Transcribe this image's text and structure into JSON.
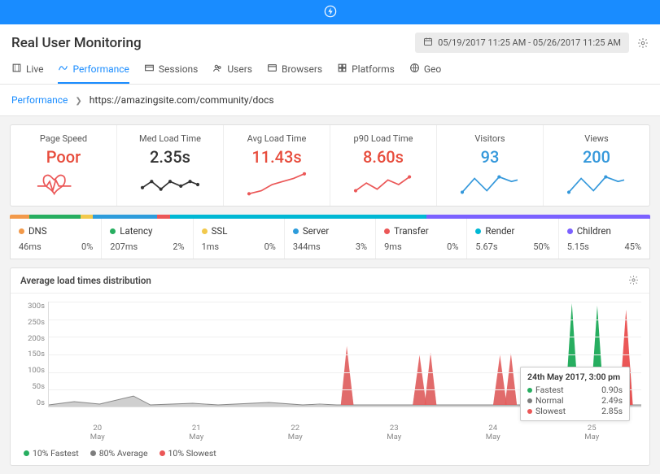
{
  "header": {
    "title": "Real User Monitoring",
    "date_range": "05/19/2017 11:25 AM - 05/26/2017 11:25 AM"
  },
  "tabs": [
    {
      "id": "live",
      "label": "Live"
    },
    {
      "id": "performance",
      "label": "Performance",
      "active": true
    },
    {
      "id": "sessions",
      "label": "Sessions"
    },
    {
      "id": "users",
      "label": "Users"
    },
    {
      "id": "browsers",
      "label": "Browsers"
    },
    {
      "id": "platforms",
      "label": "Platforms"
    },
    {
      "id": "geo",
      "label": "Geo"
    }
  ],
  "breadcrumb": {
    "root": "Performance",
    "path": "https://amazingsite.com/community/docs"
  },
  "metrics": [
    {
      "label": "Page Speed",
      "value": "Poor",
      "color": "red",
      "spark": "heart"
    },
    {
      "label": "Med Load Time",
      "value": "2.35s",
      "color": "black",
      "spark": "black-line"
    },
    {
      "label": "Avg Load Time",
      "value": "11.43s",
      "color": "red",
      "spark": "red-line"
    },
    {
      "label": "p90 Load Time",
      "value": "8.60s",
      "color": "red",
      "spark": "red-line2"
    },
    {
      "label": "Visitors",
      "value": "93",
      "color": "blue",
      "spark": "blue-line"
    },
    {
      "label": "Views",
      "value": "200",
      "color": "blue",
      "spark": "blue-line"
    }
  ],
  "timing": [
    {
      "name": "DNS",
      "color": "#f2994a",
      "ms": "46ms",
      "pct": "0%",
      "bar": 3
    },
    {
      "name": "Latency",
      "color": "#27ae60",
      "ms": "207ms",
      "pct": "2%",
      "bar": 8
    },
    {
      "name": "SSL",
      "color": "#f2c94c",
      "ms": "1ms",
      "pct": "0%",
      "bar": 2
    },
    {
      "name": "Server",
      "color": "#2d9cdb",
      "ms": "344ms",
      "pct": "3%",
      "bar": 10
    },
    {
      "name": "Transfer",
      "color": "#eb5757",
      "ms": "9ms",
      "pct": "0%",
      "bar": 2
    },
    {
      "name": "Render",
      "color": "#00b8d4",
      "ms": "5.67s",
      "pct": "50%",
      "bar": 40
    },
    {
      "name": "Children",
      "color": "#7b61ff",
      "ms": "5.15s",
      "pct": "45%",
      "bar": 35
    }
  ],
  "chart": {
    "title": "Average load times distribution",
    "y_ticks": [
      "300s",
      "250s",
      "200s",
      "150s",
      "100s",
      "50s",
      "0s"
    ],
    "x_ticks": [
      "20\nMay",
      "21\nMay",
      "22\nMay",
      "23\nMay",
      "24\nMay",
      "25\nMay"
    ],
    "legend": [
      {
        "color": "#27ae60",
        "label": "10% Fastest"
      },
      {
        "color": "#7d7d7d",
        "label": "80% Average"
      },
      {
        "color": "#eb5757",
        "label": "10% Slowest"
      }
    ],
    "tooltip": {
      "title": "24th May 2017, 3:00 pm",
      "rows": [
        {
          "label": "Fastest",
          "value": "0.90s",
          "color": "#27ae60"
        },
        {
          "label": "Normal",
          "value": "2.49s",
          "color": "#7d7d7d"
        },
        {
          "label": "Slowest",
          "value": "2.85s",
          "color": "#eb5757"
        }
      ]
    }
  },
  "chart_data": {
    "type": "area",
    "title": "Average load times distribution",
    "ylabel": "seconds",
    "ylim": [
      0,
      300
    ],
    "x_dates": [
      "2017-05-20",
      "2017-05-21",
      "2017-05-22",
      "2017-05-23",
      "2017-05-24",
      "2017-05-25"
    ],
    "series": [
      {
        "name": "10% Fastest",
        "color": "#27ae60",
        "peak_values": [
          5,
          5,
          5,
          5,
          5,
          300
        ]
      },
      {
        "name": "80% Average",
        "color": "#7d7d7d",
        "peak_values": [
          25,
          10,
          155,
          125,
          130,
          10
        ]
      },
      {
        "name": "10% Slowest",
        "color": "#eb5757",
        "peak_values": [
          8,
          8,
          170,
          145,
          145,
          280
        ]
      }
    ],
    "note": "baseline ~5s with occasional spikes; late May 25 shows tall green and red spikes near 300s"
  }
}
